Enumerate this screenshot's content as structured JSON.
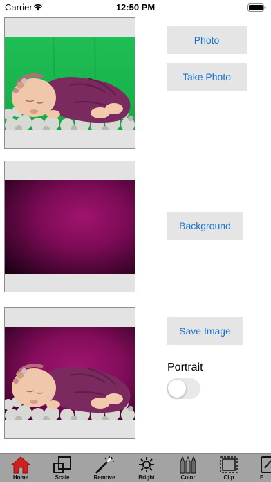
{
  "status_bar": {
    "carrier": "Carrier",
    "time": "12:50 PM"
  },
  "buttons": {
    "photo": "Photo",
    "take_photo": "Take Photo",
    "background": "Background",
    "save_image": "Save Image"
  },
  "portrait": {
    "label": "Portrait",
    "enabled": false
  },
  "colors": {
    "link_blue": "#1673d6",
    "button_gray": "#e5e5e5",
    "tab_bar_gray": "#a3a3a3",
    "home_red": "#d02020",
    "green_screen": "#1fbf55",
    "magenta_background": "#8a0d5f"
  },
  "tab_bar": {
    "items": [
      {
        "label": "Home",
        "icon": "home-icon",
        "selected": true
      },
      {
        "label": "Scale",
        "icon": "scale-icon",
        "selected": false
      },
      {
        "label": "Remove",
        "icon": "magic-wand-icon",
        "selected": false
      },
      {
        "label": "Bright",
        "icon": "sun-icon",
        "selected": false
      },
      {
        "label": "Color",
        "icon": "crayons-icon",
        "selected": false
      },
      {
        "label": "Clip",
        "icon": "clip-icon",
        "selected": false
      },
      {
        "label": "E",
        "icon": "edit-icon",
        "selected": false
      }
    ]
  }
}
